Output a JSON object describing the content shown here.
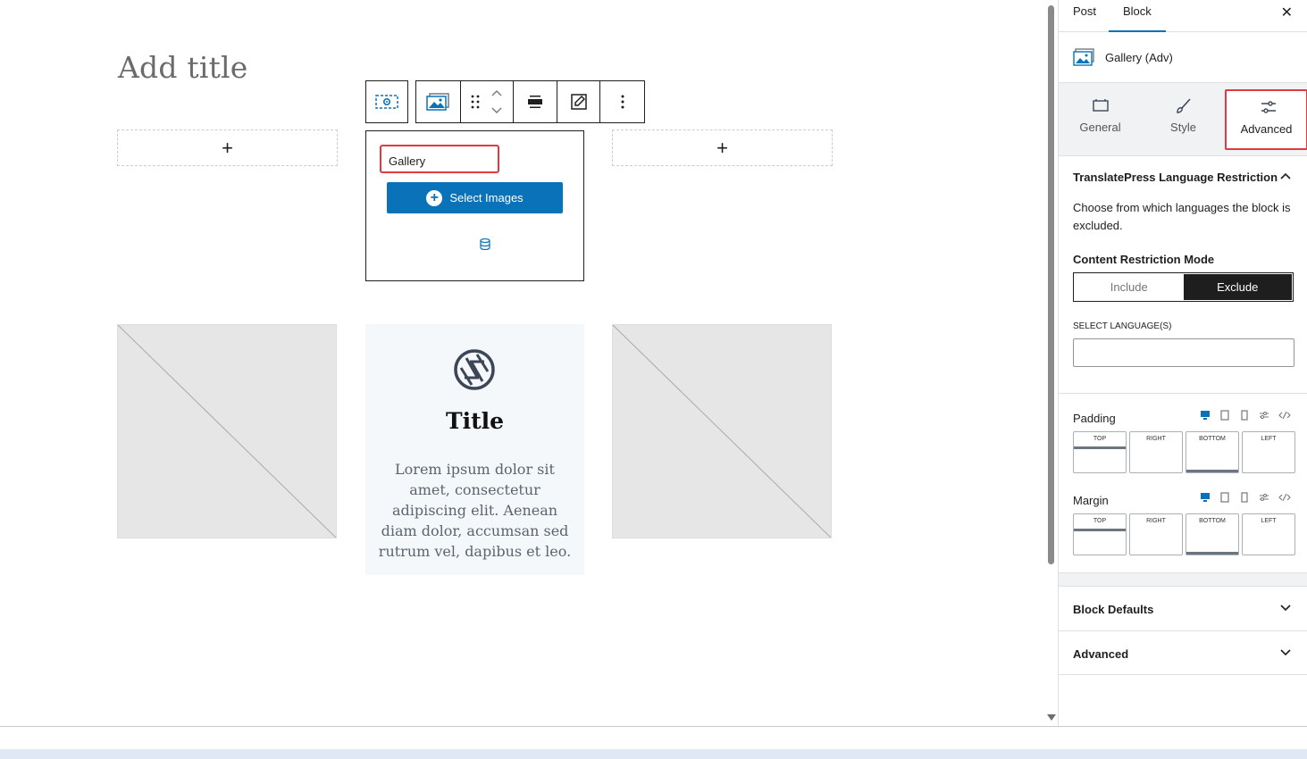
{
  "editor": {
    "post_title_placeholder": "Add title",
    "add_block_symbol": "+",
    "gallery_block": {
      "label": "Gallery",
      "select_images_label": "Select Images"
    },
    "info_box": {
      "title": "Title",
      "text": "Lorem ipsum dolor sit amet, consectetur adipiscing elit. Aenean diam dolor, accumsan sed rutrum vel, dapibus et leo."
    }
  },
  "sidebar": {
    "tabs": [
      "Post",
      "Block"
    ],
    "active_tab": "Block",
    "close_symbol": "✕",
    "block_name": "Gallery (Adv)",
    "inspector_tabs": [
      {
        "label": "General",
        "icon": "general-box-icon"
      },
      {
        "label": "Style",
        "icon": "brush-icon"
      },
      {
        "label": "Advanced",
        "icon": "sliders-icon"
      }
    ],
    "active_inspector_tab": "Advanced",
    "translatepress": {
      "title": "TranslatePress Language Restriction",
      "description": "Choose from which languages the block is excluded.",
      "mode_label": "Content Restriction Mode",
      "mode_options": [
        "Include",
        "Exclude"
      ],
      "mode_selected": "Exclude",
      "select_languages_label": "SELECT LANGUAGE(S)",
      "select_languages_value": ""
    },
    "padding": {
      "label": "Padding",
      "sides": [
        "TOP",
        "RIGHT",
        "BOTTOM",
        "LEFT"
      ]
    },
    "margin": {
      "label": "Margin",
      "sides": [
        "TOP",
        "RIGHT",
        "BOTTOM",
        "LEFT"
      ]
    },
    "collapsed_panels": [
      "Block Defaults",
      "Advanced"
    ]
  },
  "colors": {
    "accent": "#0a72b8",
    "highlight_outline": "#e0393e",
    "dark": "#1e1e1e"
  }
}
